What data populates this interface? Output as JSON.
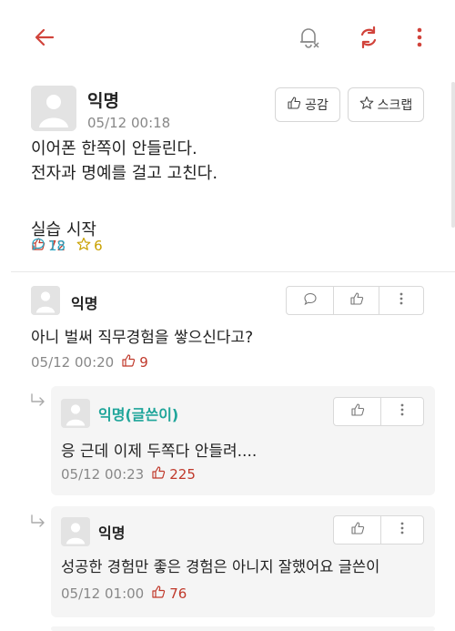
{
  "topbar": {
    "icons": [
      "back-arrow-icon",
      "bell-off-icon",
      "refresh-icon",
      "more-vertical-icon"
    ],
    "accent": "#d1433b"
  },
  "post": {
    "author": "익명",
    "time": "05/12 00:18",
    "like_label": "공감",
    "scrap_label": "스크랩",
    "body_lines": [
      "이어폰 한쪽이 안들린다.",
      "전자과 명예를 걸고 고친다.",
      "",
      "실습 시작"
    ],
    "likes": "72",
    "comments": "18",
    "scraps": "6"
  },
  "comments": [
    {
      "author": "익명",
      "body": "아니 벌써 직무경험을 쌓으신다고?",
      "time": "05/12 00:20",
      "likes": "9"
    }
  ],
  "replies": [
    {
      "author": "익명(글쓴이)",
      "is_op": true,
      "body": "응 근데 이제 두쪽다 안들려....",
      "time": "05/12 00:23",
      "likes": "225"
    },
    {
      "author": "익명",
      "is_op": false,
      "body": "성공한 경험만 좋은 경험은 아니지 잘했어요 글쓴이",
      "time": "05/12 01:00",
      "likes": "76"
    }
  ],
  "colors": {
    "like": "#c0392b",
    "comment": "#2aa6c4",
    "star": "#c9a100",
    "op_name": "#1fa59a"
  }
}
